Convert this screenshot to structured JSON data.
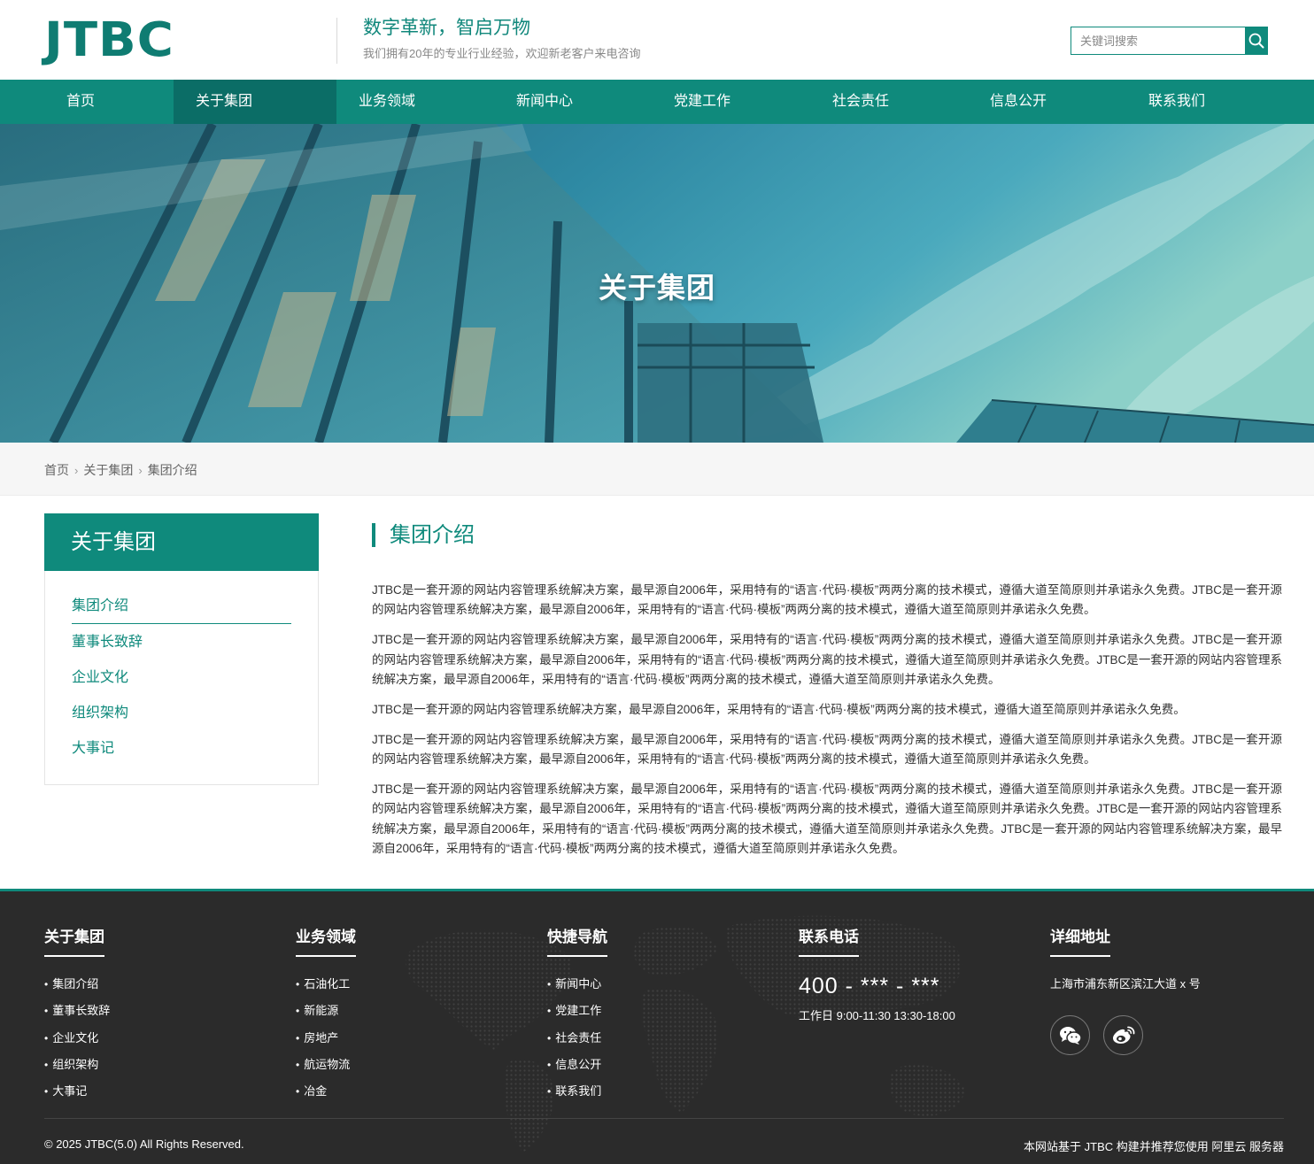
{
  "header": {
    "logo": "JTBC",
    "slogan": "数字革新，智启万物",
    "subslogan": "我们拥有20年的专业行业经验，欢迎新老客户来电咨询",
    "search_placeholder": "关键词搜索"
  },
  "nav": {
    "items": [
      "首页",
      "关于集团",
      "业务领域",
      "新闻中心",
      "党建工作",
      "社会责任",
      "信息公开",
      "联系我们"
    ],
    "active": "关于集团"
  },
  "banner": {
    "title": "关于集团"
  },
  "breadcrumb": {
    "items": [
      "首页",
      "关于集团",
      "集团介绍"
    ]
  },
  "sidebar": {
    "title": "关于集团",
    "items": [
      "集团介绍",
      "董事长致辞",
      "企业文化",
      "组织架构",
      "大事记"
    ],
    "active": "集团介绍"
  },
  "content": {
    "title": "集团介绍",
    "paragraphs": [
      "JTBC是一套开源的网站内容管理系统解决方案，最早源自2006年，采用特有的“语言·代码·模板”两两分离的技术模式，遵循大道至简原则并承诺永久免费。JTBC是一套开源的网站内容管理系统解决方案，最早源自2006年，采用特有的“语言·代码·模板”两两分离的技术模式，遵循大道至简原则并承诺永久免费。",
      "JTBC是一套开源的网站内容管理系统解决方案，最早源自2006年，采用特有的“语言·代码·模板”两两分离的技术模式，遵循大道至简原则并承诺永久免费。JTBC是一套开源的网站内容管理系统解决方案，最早源自2006年，采用特有的“语言·代码·模板”两两分离的技术模式，遵循大道至简原则并承诺永久免费。JTBC是一套开源的网站内容管理系统解决方案，最早源自2006年，采用特有的“语言·代码·模板”两两分离的技术模式，遵循大道至简原则并承诺永久免费。",
      "JTBC是一套开源的网站内容管理系统解决方案，最早源自2006年，采用特有的“语言·代码·模板”两两分离的技术模式，遵循大道至简原则并承诺永久免费。",
      "JTBC是一套开源的网站内容管理系统解决方案，最早源自2006年，采用特有的“语言·代码·模板”两两分离的技术模式，遵循大道至简原则并承诺永久免费。JTBC是一套开源的网站内容管理系统解决方案，最早源自2006年，采用特有的“语言·代码·模板”两两分离的技术模式，遵循大道至简原则并承诺永久免费。",
      "JTBC是一套开源的网站内容管理系统解决方案，最早源自2006年，采用特有的“语言·代码·模板”两两分离的技术模式，遵循大道至简原则并承诺永久免费。JTBC是一套开源的网站内容管理系统解决方案，最早源自2006年，采用特有的“语言·代码·模板”两两分离的技术模式，遵循大道至简原则并承诺永久免费。JTBC是一套开源的网站内容管理系统解决方案，最早源自2006年，采用特有的“语言·代码·模板”两两分离的技术模式，遵循大道至简原则并承诺永久免费。JTBC是一套开源的网站内容管理系统解决方案，最早源自2006年，采用特有的“语言·代码·模板”两两分离的技术模式，遵循大道至简原则并承诺永久免费。"
    ]
  },
  "footer": {
    "about": {
      "title": "关于集团",
      "items": [
        "集团介绍",
        "董事长致辞",
        "企业文化",
        "组织架构",
        "大事记"
      ]
    },
    "business": {
      "title": "业务领域",
      "items": [
        "石油化工",
        "新能源",
        "房地产",
        "航运物流",
        "冶金"
      ]
    },
    "quicknav": {
      "title": "快捷导航",
      "items": [
        "新闻中心",
        "党建工作",
        "社会责任",
        "信息公开",
        "联系我们"
      ]
    },
    "contact": {
      "title": "联系电话",
      "phone": "400 - *** - ***",
      "hours": "工作日 9:00-11:30 13:30-18:00"
    },
    "address": {
      "title": "详细地址",
      "text": "上海市浦东新区滨江大道 x 号"
    },
    "social": [
      "wechat-icon",
      "weibo-icon"
    ],
    "copyright": "© 2025 JTBC(5.0) All Rights Reserved.",
    "powered": "本网站基于 JTBC 构建并推荐您使用 阿里云 服务器"
  },
  "colors": {
    "brand": "#0f8a7c",
    "nav_active": "#0b6d66",
    "footer_bg": "#2b2b2b"
  }
}
